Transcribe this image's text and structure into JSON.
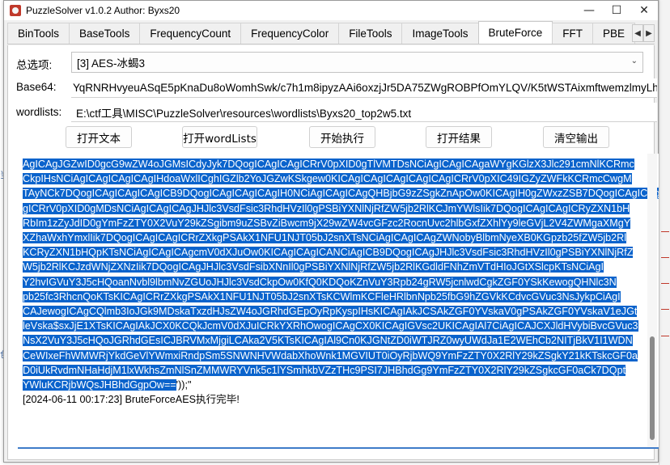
{
  "window": {
    "title": "PuzzleSolver v1.0.2  Author:  Byxs20",
    "controls": {
      "minimize": "—",
      "maximize": "☐",
      "close": "✕"
    }
  },
  "tabs": [
    {
      "label": "BinTools"
    },
    {
      "label": "BaseTools"
    },
    {
      "label": "FrequencyCount"
    },
    {
      "label": "FrequencyColor"
    },
    {
      "label": "FileTools"
    },
    {
      "label": "ImageTools"
    },
    {
      "label": "BruteForce",
      "active": true
    },
    {
      "label": "FFT"
    },
    {
      "label": "PBE"
    }
  ],
  "tab_scroll": {
    "left": "◀",
    "right": "▶"
  },
  "options": {
    "label": "总选项:",
    "selected": "[3] AES-冰蝎3"
  },
  "base64": {
    "label": "Base64:",
    "value": "YqRNRHvyeuASqE5pKnaDu8oWomhSwk/c7h1m8ipyzAAi6oxzjJr5DA75ZWgROBPfOmYLQV/K5tWSTAixmftwemzlmyLhA="
  },
  "wordlists": {
    "label": "wordlists:",
    "value": "E:\\ctf工具\\MISC\\PuzzleSolver\\resources\\wordlists\\Byxs20_top2w5.txt"
  },
  "buttons": {
    "open_text": "打开文本",
    "open_wordlists": "打开wordLists",
    "start": "开始执行",
    "open_result": "打开结果",
    "clear_output": "清空输出"
  },
  "output": {
    "selected_lines": [
      "AgICAgJGZwID0gcG9wZW4oJGMsICdyJyk7DQogICAgICAgICRrV0pXID0gTlVMTDsNCiAgICAgICAgaWYgKGlzX3Jlc291cmNlKCRmc",
      "CkpIHsNCiAgICAgICAgICAgIHdoaWxlICghIGZlb2YoJGZwKSkgew0KICAgICAgICAgICAgICAgICRrV0pXIC49IGZyZWFkKCRmcCwgM",
      "TAyNCk7DQogICAgICAgICAgICB9DQogICAgICAgICAgIH0NCiAgICAgICAgQHBjbG9zZSgkZnApOw0KICAgIH0gZWxzZSB7DQogICAgICAg",
      "gICRrV0pXID0gMDsNCiAgICAgICAgJHJlc3VsdFsic3RhdHVzIl0gPSBiYXNlNjRfZW5jb2RlKCJmYWlsIik7DQogICAgICAgICRyZXN1bH",
      "RbIm1zZyJdID0gYmFzZTY0X2VuY29kZSgibm9uZSBvZiBwcm9jX29wZW4vcGFzc2RocnUvc2hlbGxfZXhlYy9leGVjL2V4ZWMgaXMgY",
      "XZhaWxhYmxlIik7DQogICAgICAgICRrZXkgPSAkX1NFU1NJT05bJ2snXTsNCiAgICAgICAgZWNobyBlbmNyeXB0KGpzb25fZW5jb2Rl",
      "KCRyZXN1bHQpKTsNCiAgICAgICAgcmV0dXJuOw0KICAgICAgICANCiAgICB9DQogICAgJHJlc3VsdFsic3RhdHVzIl0gPSBiYXNlNjRfZ",
      "W5jb2RlKCJzdWNjZXNzIik7DQogICAgJHJlc3VsdFsibXNnIl0gPSBiYXNlNjRfZW5jb2RlKGdldFNhZmVTdHIoJGtXSlcpKTsNCiAgI",
      "Y2hvIGVuY3J5cHQoanNvbl9lbmNvZGUoJHJlc3VsdCkpOw0KfQ0KDQoKZnVuY3Rpb24gRW5jcnlwdCgkZGF0YSkKewogQHNlc3N",
      "pb25fc3RhcnQoKTsKICAgICRrZXkgPSAkX1NFU1NJT05bJ2snXTsKCWlmKCFleHRlbnNpb25fbG9hZGVkKCdvcGVuc3NsJykpCiAgI",
      "CAJewogICAgCQlmb3IoJGk9MDskaTxzdHJsZW4oJGRhdGEpOyRpKyspIHsKICAgIAkJCSAkZGF0YVskaV0gPSAkZGF0YVskaV1eJGt",
      "leVska$sxJjE1XTsKICAgIAkJCX0KCQkJcmV0dXJuICRkYXRhOwogICAgCX0KICAgIGVsc2UKICAgIAl7CiAgICAJCXJldHVybiBvcGVuc3",
      "NsX2VuY3J5cHQoJGRhdGEsICJBRVMxMjgiLCAka2V5KTsKICAgIAl9Cn0KJGNtZD0iWTJRZ0wyUWdJa1E2WEhCb2NITjBkV1I1WDN",
      "CeWIxeFhWMWRjYkdGeVlYWmxiRndpSm5SNWNHVWdabXhoWnk1MGVIUT0iOyRjbWQ9YmFzZTY0X2RlY29kZSgkY21kKTskcGF0a",
      "D0iUkRvdmNHaHdjM1lxWkhsZmNlSnZMMWRYVnk5c1lYSmhkbVZzTHc9PSI7JHBhdGg9YmFzZTY0X2RlY29kZSgkcGF0aCk7DQpt",
      "YWluKCRjbWQsJHBhdGgpOw=="
    ],
    "selected_tail_plain": "'));\"",
    "log_line": "[2024-06-11 00:17:23] BruteForceAES执行完毕!"
  }
}
